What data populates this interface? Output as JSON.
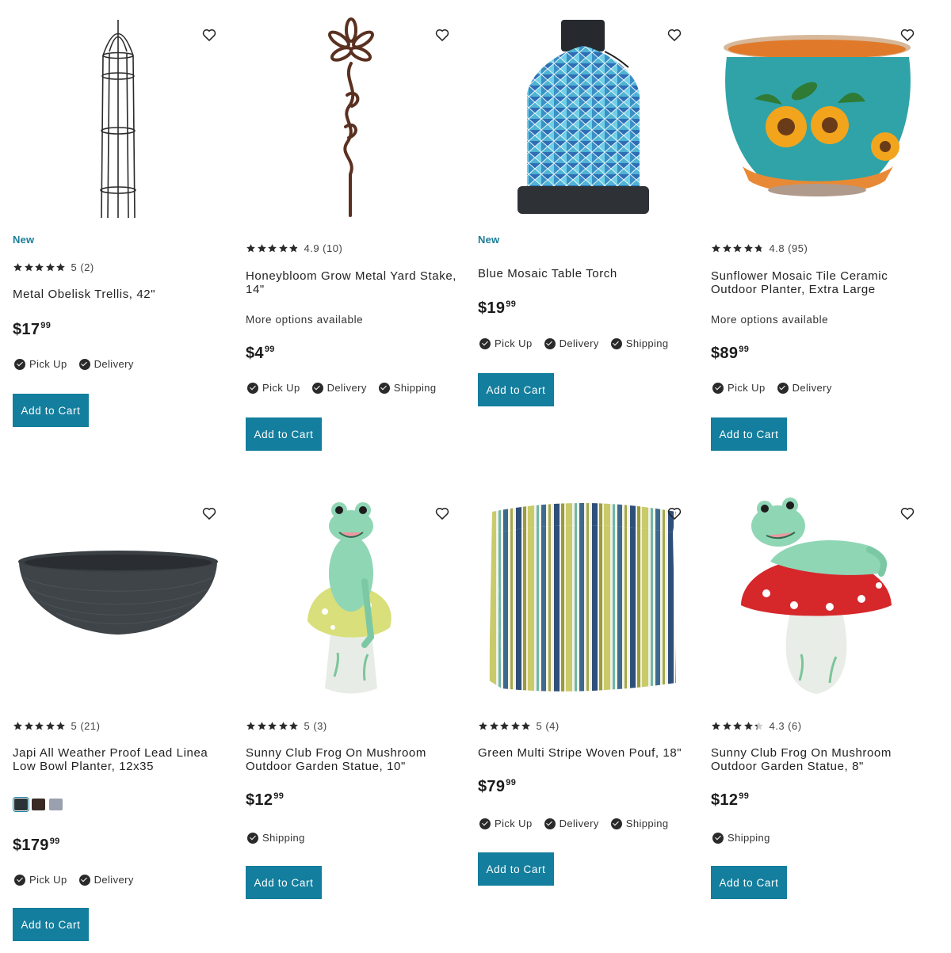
{
  "colors": {
    "accent": "#137e9d",
    "new_badge": "#1a7d98",
    "star": "#2a2a2a"
  },
  "icons": {
    "wishlist": "heart-outline-icon",
    "fulfillment": "check-circle-icon",
    "rating": "star-icon"
  },
  "products": [
    {
      "badge": "New",
      "rating": 5,
      "rating_text": "5 (2)",
      "title": "Metal Obelisk Trellis, 42\"",
      "more_options": "",
      "price_dollars": "$17",
      "price_cents": "99",
      "fulfillment": [
        "Pick Up",
        "Delivery"
      ],
      "add_to_cart": "Add to Cart"
    },
    {
      "badge": "",
      "rating": 4.9,
      "rating_text": "4.9 (10)",
      "title": "Honeybloom Grow Metal Yard Stake, 14\"",
      "more_options": "More options available",
      "price_dollars": "$4",
      "price_cents": "99",
      "fulfillment": [
        "Pick Up",
        "Delivery",
        "Shipping"
      ],
      "add_to_cart": "Add to Cart"
    },
    {
      "badge": "New",
      "rating": null,
      "rating_text": "",
      "title": "Blue Mosaic Table Torch",
      "more_options": "",
      "price_dollars": "$19",
      "price_cents": "99",
      "fulfillment": [
        "Pick Up",
        "Delivery",
        "Shipping"
      ],
      "add_to_cart": "Add to Cart"
    },
    {
      "badge": "",
      "rating": 4.8,
      "rating_text": "4.8 (95)",
      "title": "Sunflower Mosaic Tile Ceramic Outdoor Planter, Extra Large",
      "more_options": "More options available",
      "price_dollars": "$89",
      "price_cents": "99",
      "fulfillment": [
        "Pick Up",
        "Delivery"
      ],
      "add_to_cart": "Add to Cart"
    },
    {
      "badge": "",
      "rating": 5,
      "rating_text": "5 (21)",
      "title": "Japi All Weather Proof Lead Linea Low Bowl Planter, 12x35",
      "more_options": "",
      "swatches": [
        "#2b3236",
        "#3a2a24",
        "#9aa0ad"
      ],
      "price_dollars": "$179",
      "price_cents": "99",
      "fulfillment": [
        "Pick Up",
        "Delivery"
      ],
      "add_to_cart": "Add to Cart"
    },
    {
      "badge": "",
      "rating": 5,
      "rating_text": "5 (3)",
      "title": "Sunny Club Frog On Mushroom Outdoor Garden Statue, 10\"",
      "more_options": "",
      "price_dollars": "$12",
      "price_cents": "99",
      "fulfillment": [
        "Shipping"
      ],
      "add_to_cart": "Add to Cart"
    },
    {
      "badge": "",
      "rating": 5,
      "rating_text": "5 (4)",
      "title": "Green Multi Stripe Woven Pouf, 18\"",
      "more_options": "",
      "price_dollars": "$79",
      "price_cents": "99",
      "fulfillment": [
        "Pick Up",
        "Delivery",
        "Shipping"
      ],
      "add_to_cart": "Add to Cart"
    },
    {
      "badge": "",
      "rating": 4.3,
      "rating_text": "4.3 (6)",
      "title": "Sunny Club Frog On Mushroom Outdoor Garden Statue, 8\"",
      "more_options": "",
      "price_dollars": "$12",
      "price_cents": "99",
      "fulfillment": [
        "Shipping"
      ],
      "add_to_cart": "Add to Cart"
    }
  ]
}
